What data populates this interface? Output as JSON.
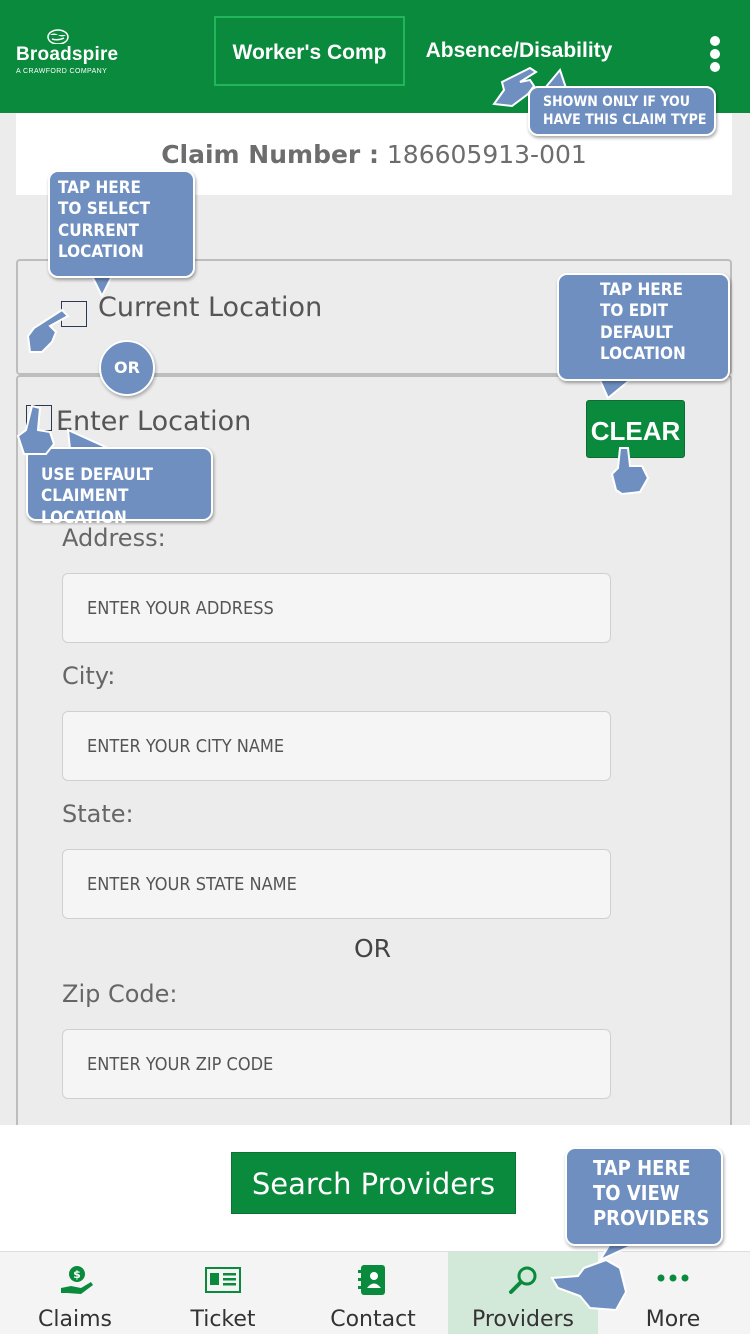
{
  "header": {
    "logo_name": "Broadspire",
    "logo_sub": "A CRAWFORD COMPANY",
    "tabs": [
      {
        "label": "Worker's Comp",
        "active": true
      },
      {
        "label": "Absence/Disability",
        "active": false
      }
    ],
    "menu_icon": "kebab-menu-icon"
  },
  "claim": {
    "label": "Claim Number :",
    "value": "186605913-001"
  },
  "location": {
    "current_label": "Current Location",
    "enter_label": "Enter Location",
    "clear_label": "CLEAR"
  },
  "form": {
    "address_label": "Address:",
    "address_placeholder": "ENTER YOUR ADDRESS",
    "city_label": "City:",
    "city_placeholder": "ENTER YOUR CITY NAME",
    "state_label": "State:",
    "state_placeholder": "ENTER YOUR STATE NAME",
    "or_text": "OR",
    "zip_label": "Zip Code:",
    "zip_placeholder": "ENTER YOUR ZIP CODE"
  },
  "search_button": "Search Providers",
  "nav": [
    {
      "label": "Claims",
      "icon": "money-hand-icon",
      "active": false
    },
    {
      "label": "Ticket",
      "icon": "ticket-icon",
      "active": false
    },
    {
      "label": "Contact",
      "icon": "contact-book-icon",
      "active": false
    },
    {
      "label": "Providers",
      "icon": "search-icon",
      "active": true
    },
    {
      "label": "More",
      "icon": "more-dots-icon",
      "active": false
    }
  ],
  "annotations": {
    "top": [
      "SHOWN ONLY IF YOU",
      "HAVE THIS CLAIM TYPE"
    ],
    "select": [
      "TAP HERE",
      "TO SELECT",
      "CURRENT",
      "LOCATION"
    ],
    "edit": [
      "TAP HERE",
      "TO EDIT",
      "DEFAULT",
      "LOCATION"
    ],
    "default": [
      "USE DEFAULT",
      "CLAIMENT LOCATION"
    ],
    "view": [
      "TAP HERE",
      "TO VIEW",
      "PROVIDERS"
    ],
    "or_circle": "OR"
  },
  "colors": {
    "brand_green": "#0a8a3c",
    "annotation_blue": "#6f8fc1",
    "active_nav_bg": "#d2e8d8"
  }
}
